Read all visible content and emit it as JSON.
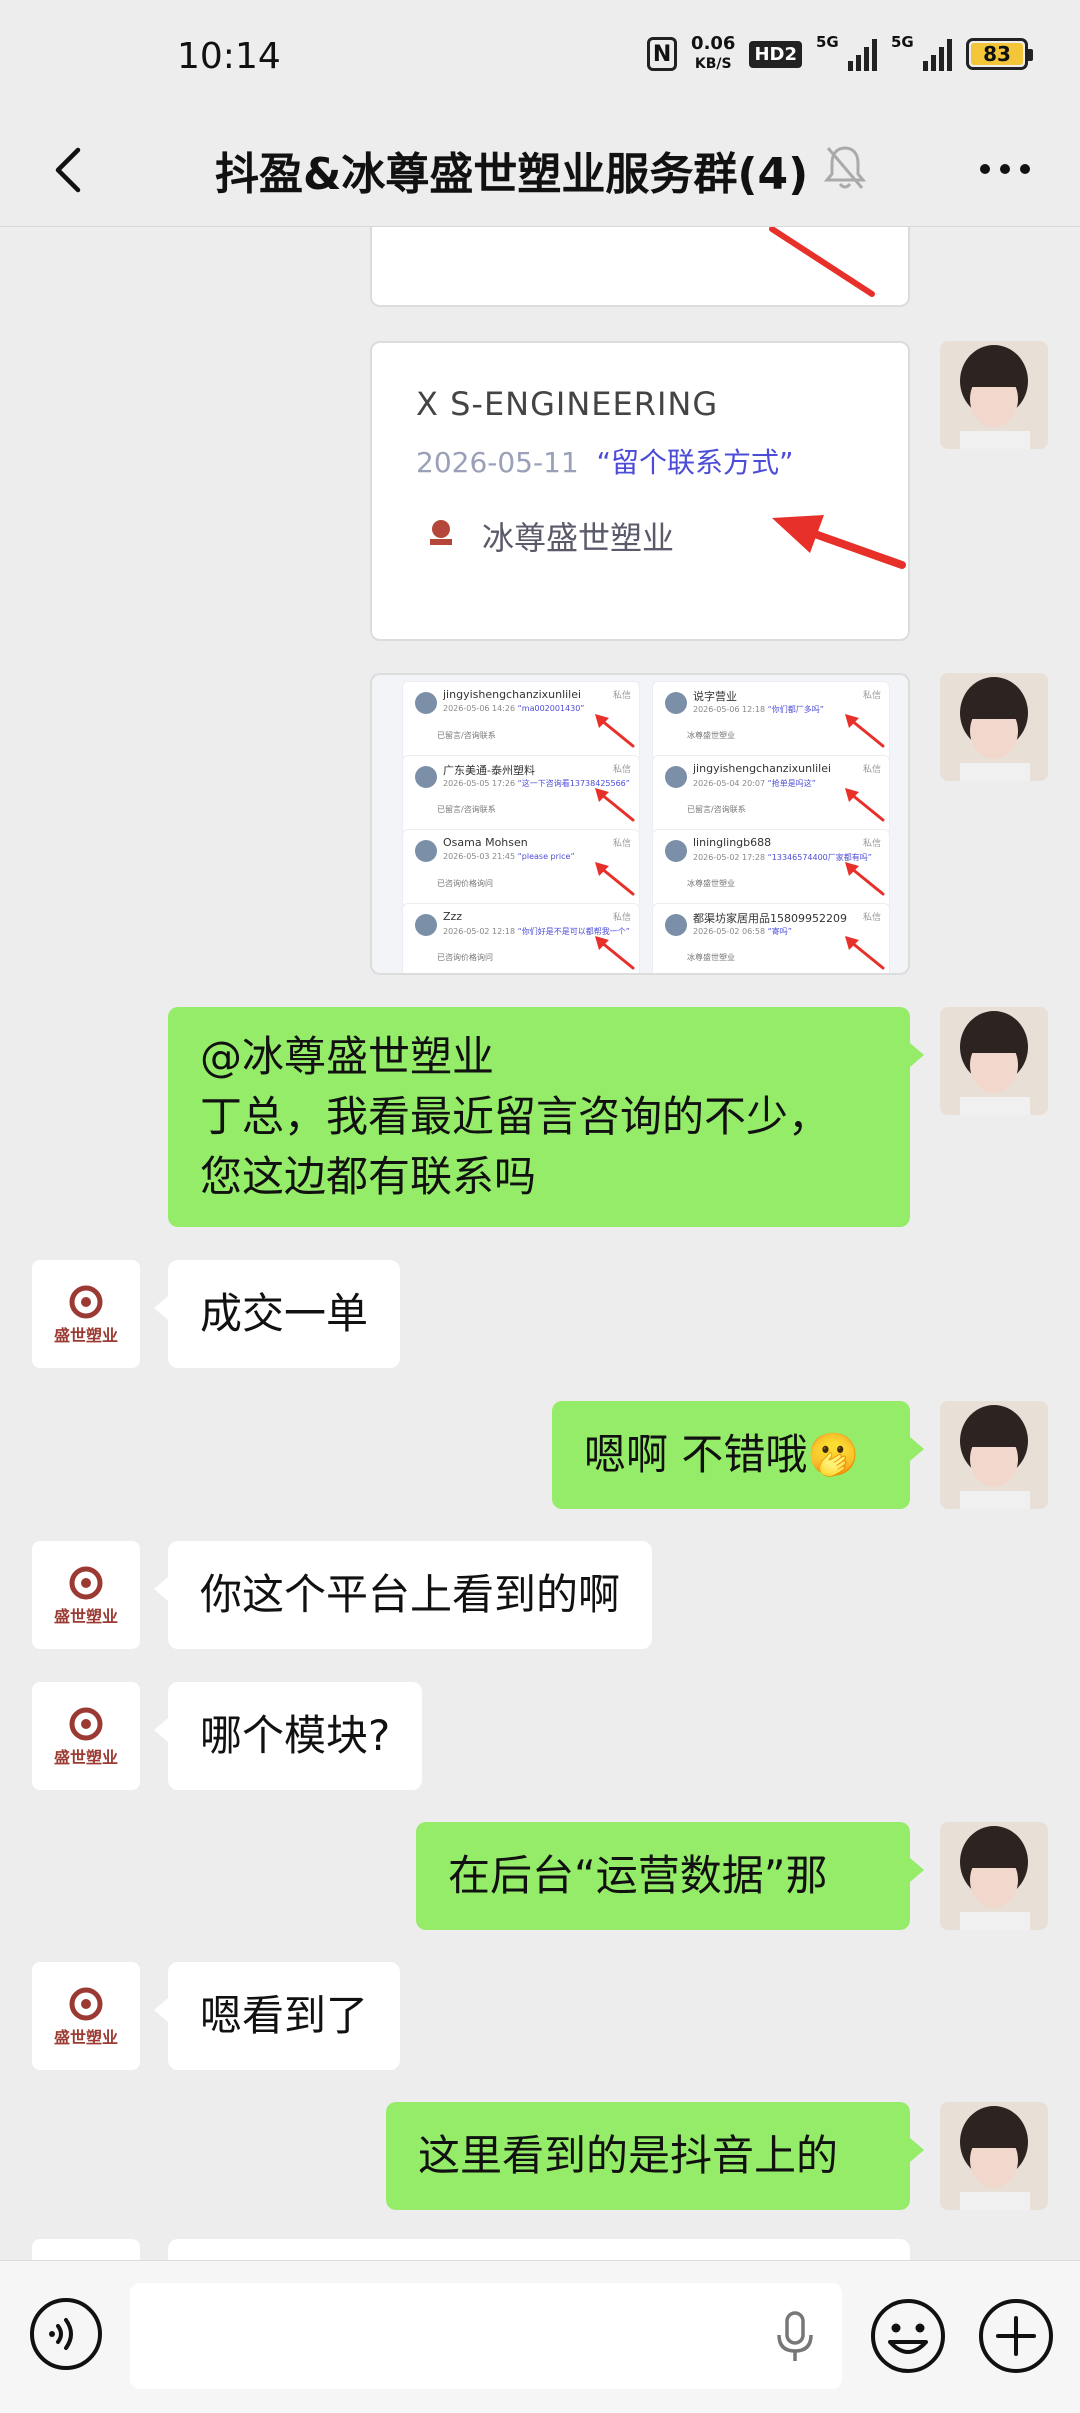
{
  "status_bar": {
    "time": "10:14",
    "net_speed_value": "0.06",
    "net_speed_unit": "KB/S",
    "hd_label": "HD2",
    "signal1_label": "5G",
    "signal2_label": "5G",
    "battery": "83",
    "nfc_label": "N"
  },
  "header": {
    "title": "抖盈&冰尊盛世塑业服务群(4)",
    "back_icon": "chevron-left-icon",
    "mute_icon": "bell-muted-icon",
    "more_icon": "more-horizontal-icon"
  },
  "messages": {
    "card1": {
      "title": "X S-ENGINEERING",
      "date": "2026-05-11",
      "quote": "“留个联系方式”",
      "company": "冰尊盛世塑业"
    },
    "grid": [
      {
        "name": "jingyishengchanzixunlilei",
        "date": "2026-05-06 14:26",
        "quote": "“ma002001430”",
        "tag": "私信",
        "sub": "已留言/咨询联系"
      },
      {
        "name": "说字营业",
        "date": "2026-05-06 12:18",
        "quote": "“你们都厂多吗”",
        "tag": "私信",
        "sub": "冰尊盛世塑业"
      },
      {
        "name": "广东美通-泰州塑料",
        "date": "2026-05-05 17:26",
        "quote": "“这一下咨询看13738425566”",
        "tag": "私信",
        "sub": "已留言/咨询联系"
      },
      {
        "name": "jingyishengchanzixunlilei",
        "date": "2026-05-04 20:07",
        "quote": "“抢单是吗这”",
        "tag": "私信",
        "sub": "已留言/咨询联系"
      },
      {
        "name": "Osama Mohsen",
        "date": "2026-05-03 21:45",
        "quote": "“please price”",
        "tag": "私信",
        "sub": "已咨询价格询问"
      },
      {
        "name": "lininglingb688",
        "date": "2026-05-02 17:28",
        "quote": "“13346574400厂家都有吗”",
        "tag": "私信",
        "sub": "冰尊盛世塑业"
      },
      {
        "name": "Zzz",
        "date": "2026-05-02 12:18",
        "quote": "“你们好是不是可以都帮我一个”",
        "tag": "私信",
        "sub": "已咨询价格询问"
      },
      {
        "name": "都渠坊家居用品15809952209",
        "date": "2026-05-02 06:58",
        "quote": "“寄吗”",
        "tag": "私信",
        "sub": "冰尊盛世塑业"
      }
    ],
    "m1": "@冰尊盛世塑业\n丁总，我看最近留言咨询的不少，\n您这边都有联系吗",
    "m2": "成交一单",
    "m3": "嗯啊 不错哦🫢",
    "m4": "你这个平台上看到的啊",
    "m5": "哪个模块?",
    "m6": "在后台“运营数据”那",
    "m7": "嗯看到了",
    "m8": "这里看到的是抖音上的",
    "them_avatar_text": "盛世塑业"
  },
  "input_bar": {
    "placeholder": "",
    "voice_icon": "voice-icon",
    "mic_icon": "microphone-icon",
    "emoji_icon": "emoji-icon",
    "plus_icon": "plus-circle-icon"
  },
  "colors": {
    "background": "#ededed",
    "my_bubble": "#95ec69",
    "their_bubble": "#ffffff",
    "accent_arrow": "#e8302a",
    "battery": "#f3c63a"
  }
}
